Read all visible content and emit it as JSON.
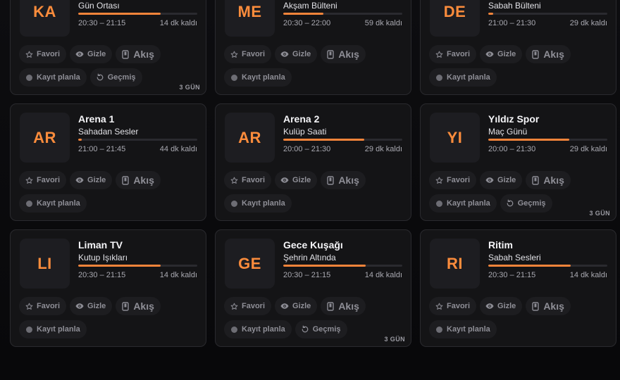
{
  "labels": {
    "favorite": "Favori",
    "hide": "Gizle",
    "flow": "Akış",
    "record": "Kayıt planla",
    "history": "Geçmiş"
  },
  "colors": {
    "accent": "#f5843a",
    "logo_text": "#fb8c3c",
    "card_bg": "#141416",
    "chip_bg": "#1d1d20"
  },
  "icons": {
    "favorite": "star-icon",
    "hide": "eye-icon",
    "flow": "phone-icon",
    "record": "record-dot-icon",
    "history": "history-icon"
  },
  "channels": [
    {
      "initials": "KA",
      "name": "",
      "program": "Gün Ortası",
      "time": "20:30 – 21:15",
      "remaining": "14 dk kaldı",
      "progress": 0.69,
      "history": true,
      "days": "3 GÜN"
    },
    {
      "initials": "ME",
      "name": "",
      "program": "Akşam Bülteni",
      "time": "20:30 – 22:00",
      "remaining": "59 dk kaldı",
      "progress": 0.34,
      "history": false,
      "days": ""
    },
    {
      "initials": "DE",
      "name": "",
      "program": "Sabah Bülteni",
      "time": "21:00 – 21:30",
      "remaining": "29 dk kaldı",
      "progress": 0.04,
      "history": false,
      "days": ""
    },
    {
      "initials": "AR",
      "name": "Arena 1",
      "program": "Sahadan Sesler",
      "time": "21:00 – 21:45",
      "remaining": "44 dk kaldı",
      "progress": 0.03,
      "history": false,
      "days": ""
    },
    {
      "initials": "AR",
      "name": "Arena 2",
      "program": "Kulüp Saati",
      "time": "20:00 – 21:30",
      "remaining": "29 dk kaldı",
      "progress": 0.68,
      "history": false,
      "days": ""
    },
    {
      "initials": "YI",
      "name": "Yıldız Spor",
      "program": "Maç Günü",
      "time": "20:00 – 21:30",
      "remaining": "29 dk kaldı",
      "progress": 0.68,
      "history": true,
      "days": "3 GÜN"
    },
    {
      "initials": "LI",
      "name": "Liman TV",
      "program": "Kutup Işıkları",
      "time": "20:30 – 21:15",
      "remaining": "14 dk kaldı",
      "progress": 0.69,
      "history": false,
      "days": ""
    },
    {
      "initials": "GE",
      "name": "Gece Kuşağı",
      "program": "Şehrin Altında",
      "time": "20:30 – 21:15",
      "remaining": "14 dk kaldı",
      "progress": 0.69,
      "history": true,
      "days": "3 GÜN"
    },
    {
      "initials": "RI",
      "name": "Ritim",
      "program": "Sabah Sesleri",
      "time": "20:30 – 21:15",
      "remaining": "14 dk kaldı",
      "progress": 0.69,
      "history": false,
      "days": ""
    }
  ]
}
